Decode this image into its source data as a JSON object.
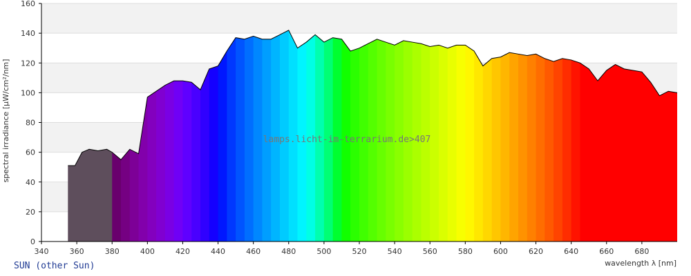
{
  "chart_data": {
    "type": "area",
    "ylabel": "spectral irradiance [µW/cm²/nm]",
    "xlabel": "wavelength λ [nm]",
    "xlim": [
      340,
      700
    ],
    "ylim": [
      0,
      160
    ],
    "xticks": [
      340,
      360,
      380,
      400,
      420,
      440,
      460,
      480,
      500,
      520,
      540,
      560,
      580,
      600,
      620,
      640,
      660,
      680
    ],
    "yticks": [
      0,
      20,
      40,
      60,
      80,
      100,
      120,
      140,
      160
    ],
    "grid": "horizontal bands",
    "annotation": "lamps.licht-im-terrarium.de>407",
    "caption": "SUN (other Sun)",
    "uv_fill_color": "#5e4e5c",
    "x": [
      355,
      359,
      363,
      367,
      372,
      377,
      380,
      385,
      390,
      395,
      400,
      405,
      410,
      415,
      420,
      425,
      430,
      435,
      440,
      445,
      450,
      455,
      460,
      465,
      470,
      475,
      480,
      485,
      490,
      495,
      500,
      505,
      510,
      515,
      520,
      525,
      530,
      535,
      540,
      545,
      550,
      555,
      560,
      565,
      570,
      575,
      580,
      585,
      590,
      595,
      600,
      605,
      610,
      615,
      620,
      625,
      630,
      635,
      640,
      645,
      650,
      655,
      660,
      665,
      670,
      675,
      680,
      685,
      690,
      695,
      700
    ],
    "y": [
      51,
      51,
      60,
      62,
      61,
      62,
      60,
      55,
      62,
      59,
      97,
      101,
      105,
      108,
      108,
      107,
      102,
      116,
      118,
      128,
      137,
      136,
      138,
      136,
      136,
      139,
      142,
      130,
      134,
      139,
      134,
      137,
      136,
      128,
      130,
      133,
      136,
      134,
      132,
      135,
      134,
      133,
      131,
      132,
      130,
      132,
      132,
      128,
      118,
      123,
      124,
      127,
      126,
      125,
      126,
      123,
      121,
      123,
      122,
      120,
      116,
      108,
      115,
      119,
      116,
      115,
      114,
      107,
      98,
      101,
      100
    ]
  }
}
